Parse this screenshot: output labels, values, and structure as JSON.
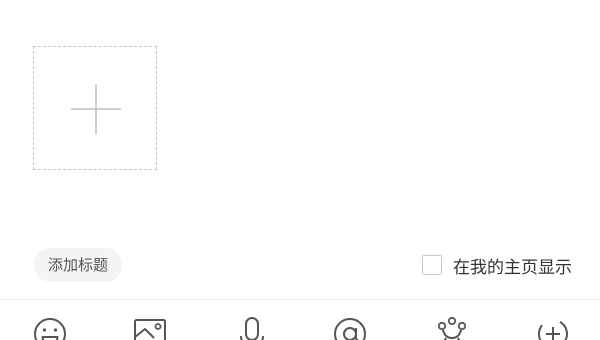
{
  "composer": {
    "add_image_icon": "plus-icon",
    "add_title_label": "添加标题",
    "show_on_homepage": {
      "label": "在我的主页显示",
      "checked": false
    }
  },
  "toolbar": {
    "items": [
      {
        "name": "emoji",
        "icon": "emoji-icon"
      },
      {
        "name": "image",
        "icon": "image-icon"
      },
      {
        "name": "voice",
        "icon": "microphone-icon"
      },
      {
        "name": "mention",
        "icon": "at-icon"
      },
      {
        "name": "topic",
        "icon": "topic-icon"
      },
      {
        "name": "more",
        "icon": "plus-circle-icon"
      }
    ]
  },
  "colors": {
    "icon": "#555555",
    "border": "#c4c4c4",
    "pill_bg": "#f4f4f4",
    "text": "#333333"
  }
}
